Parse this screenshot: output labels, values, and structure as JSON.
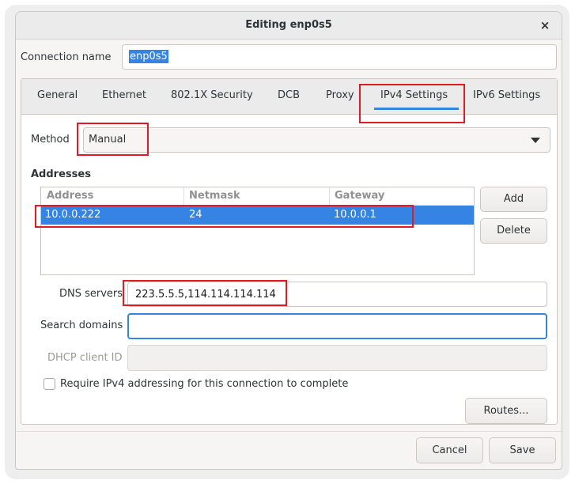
{
  "window": {
    "title": "Editing enp0s5",
    "close_glyph": "×"
  },
  "connection_name": {
    "label": "Connection name",
    "value": "enp0s5"
  },
  "tabs": [
    {
      "label": "General"
    },
    {
      "label": "Ethernet"
    },
    {
      "label": "802.1X Security"
    },
    {
      "label": "DCB"
    },
    {
      "label": "Proxy"
    },
    {
      "label": "IPv4 Settings",
      "active": true
    },
    {
      "label": "IPv6 Settings"
    }
  ],
  "ipv4": {
    "method_label": "Method",
    "method_value": "Manual",
    "addresses_heading": "Addresses",
    "columns": [
      "Address",
      "Netmask",
      "Gateway"
    ],
    "rows": [
      {
        "address": "10.0.0.222",
        "netmask": "24",
        "gateway": "10.0.0.1",
        "selected": true
      }
    ],
    "add_button": "Add",
    "delete_button": "Delete",
    "dns_label": "DNS servers",
    "dns_value": "223.5.5.5,114.114.114.114",
    "search_label": "Search domains",
    "search_value": "",
    "dhcp_label": "DHCP client ID",
    "dhcp_value": "",
    "require_label": "Require IPv4 addressing for this connection to complete",
    "require_checked": false,
    "routes_button": "Routes..."
  },
  "footer": {
    "cancel": "Cancel",
    "save": "Save"
  },
  "colors": {
    "accent": "#3584e4",
    "highlight_box": "#e01b24"
  }
}
